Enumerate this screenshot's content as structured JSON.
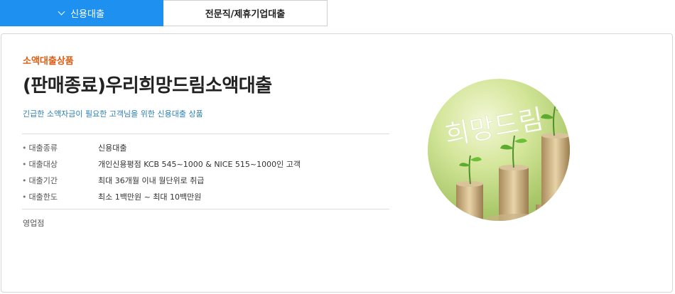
{
  "tabs": [
    {
      "label": "신용대출",
      "active": true
    },
    {
      "label": "전문직/제휴기업대출",
      "active": false
    }
  ],
  "product": {
    "category": "소액대출상품",
    "title": "(판매종료)우리희망드림소액대출",
    "description": "긴급한 소액자금이 필요한 고객님을 위한 신용대출 상품",
    "details": [
      {
        "label": "대출종류",
        "value": "신용대출"
      },
      {
        "label": "대출대상",
        "value": "개인신용평점 KCB 545~1000 & NICE 515~1000인 고객"
      },
      {
        "label": "대출기간",
        "value": "최대 36개월 이내 월단위로 취급"
      },
      {
        "label": "대출한도",
        "value": "최소 1백만원 ~ 최대 10백만원"
      }
    ],
    "branch_label": "영업점",
    "image_text": "희망드림"
  },
  "colors": {
    "tab_active_bg": "#1e90f0",
    "category": "#e05a10",
    "description": "#2a7fb8"
  }
}
